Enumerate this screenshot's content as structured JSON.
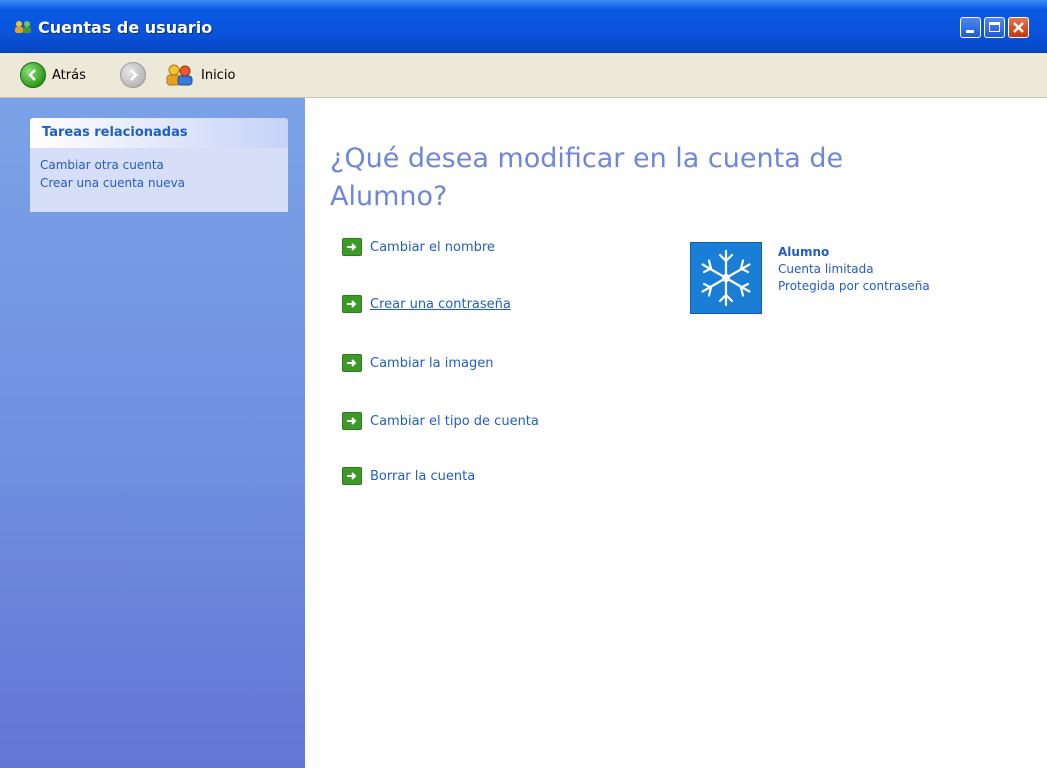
{
  "window": {
    "title": "Cuentas de usuario"
  },
  "toolbar": {
    "back_label": "Atrás",
    "home_label": "Inicio"
  },
  "sidebar": {
    "heading": "Tareas relacionadas",
    "links": [
      {
        "label": "Cambiar otra cuenta"
      },
      {
        "label": "Crear una cuenta nueva"
      }
    ]
  },
  "main": {
    "title": "¿Qué desea modificar en la cuenta de Alumno?",
    "actions": [
      {
        "label": "Cambiar el nombre",
        "underlined": false
      },
      {
        "label": "Crear una contraseña",
        "underlined": true
      },
      {
        "label": "Cambiar la imagen",
        "underlined": false
      },
      {
        "label": "Cambiar el tipo de cuenta",
        "underlined": false
      },
      {
        "label": "Borrar la cuenta",
        "underlined": false
      }
    ]
  },
  "account": {
    "name": "Alumno",
    "type": "Cuenta limitada",
    "status": "Protegida por contraseña",
    "picture_icon": "snowflake-icon"
  },
  "colors": {
    "link": "#215dc6",
    "title_text": "#6f87d8",
    "action_arrow": "#3c9a28",
    "titlebar": "#0a54dc"
  }
}
